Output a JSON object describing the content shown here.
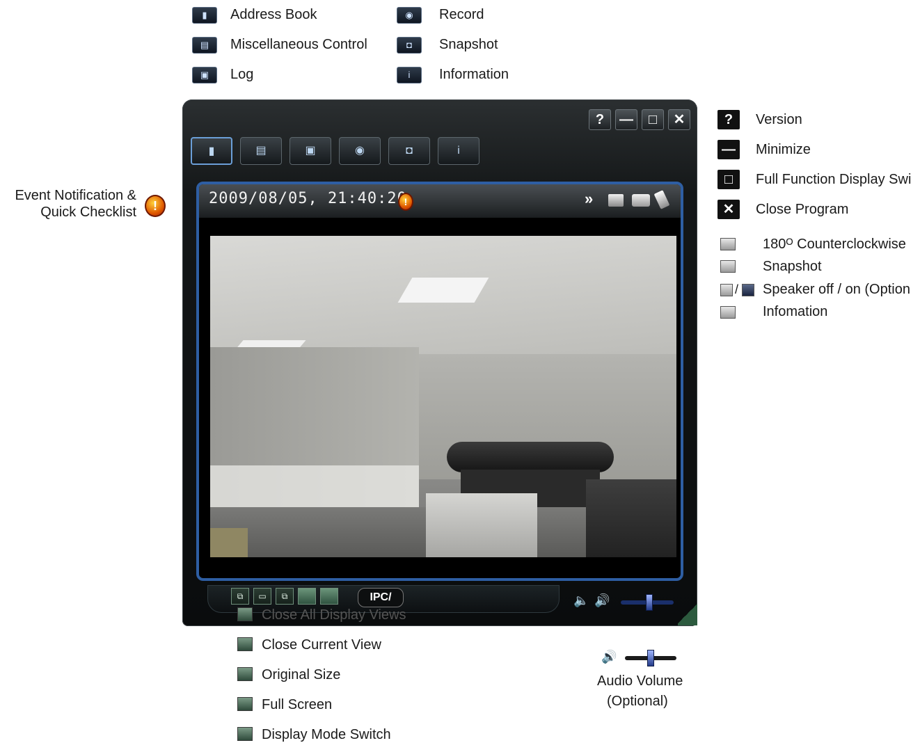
{
  "top_legend": {
    "col1": [
      "Address Book",
      "Miscellaneous Control",
      "Log"
    ],
    "col2": [
      "Record",
      "Snapshot",
      "Information"
    ]
  },
  "left_annotation": {
    "line1": "Event Notification &",
    "line2": "Quick Checklist"
  },
  "right_legend": {
    "window_buttons": [
      "Version",
      "Minimize",
      "Full Function Display Swi",
      "Close Program"
    ],
    "video_icons": [
      "180ᴼ Counterclockwise",
      "Snapshot",
      "Speaker off / on (Option",
      "Infomation"
    ]
  },
  "window": {
    "version_glyph": "?",
    "minimize_glyph": "—",
    "maximize_glyph": "□",
    "close_glyph": "✕"
  },
  "viewer": {
    "timestamp": "2009/08/05, 21:40:20",
    "alert_glyph": "!"
  },
  "bottom_bar": {
    "ipc_label": "IPC/"
  },
  "bottom_legend": [
    "Close All Display Views",
    "Close Current View",
    "Original Size",
    "Full Screen",
    "Display Mode Switch"
  ],
  "audio_annotation": {
    "line1": "Audio Volume",
    "line2": "(Optional)"
  },
  "colors": {
    "viewer_border": "#2e5ea3",
    "alert": "#e05a00",
    "active_toolbar": "#6b9fd8"
  }
}
